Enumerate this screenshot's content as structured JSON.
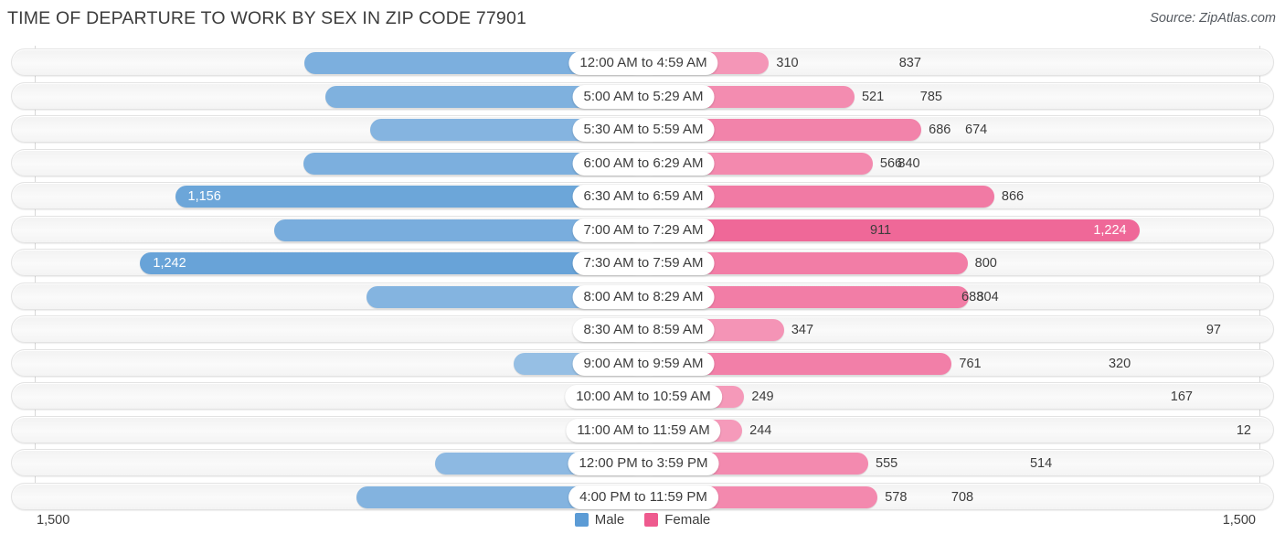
{
  "header": {
    "title": "TIME OF DEPARTURE TO WORK BY SEX IN ZIP CODE 77901",
    "source": "Source: ZipAtlas.com"
  },
  "legend": {
    "male_label": "Male",
    "female_label": "Female",
    "male_color": "#5b9bd5",
    "female_color": "#ee5a8e"
  },
  "axis": {
    "left_max_label": "1,500",
    "right_max_label": "1,500",
    "max_value": 1500
  },
  "chart_data": {
    "type": "bar",
    "title": "TIME OF DEPARTURE TO WORK BY SEX IN ZIP CODE 77901",
    "subtitle": "Source: ZipAtlas.com",
    "orientation": "horizontal-diverging",
    "xlabel": "",
    "ylabel": "",
    "xlim": [
      1500,
      1500
    ],
    "grid": true,
    "legend_position": "bottom-center",
    "categories": [
      "12:00 AM to 4:59 AM",
      "5:00 AM to 5:29 AM",
      "5:30 AM to 5:59 AM",
      "6:00 AM to 6:29 AM",
      "6:30 AM to 6:59 AM",
      "7:00 AM to 7:29 AM",
      "7:30 AM to 7:59 AM",
      "8:00 AM to 8:29 AM",
      "8:30 AM to 8:59 AM",
      "9:00 AM to 9:59 AM",
      "10:00 AM to 10:59 AM",
      "11:00 AM to 11:59 AM",
      "12:00 PM to 3:59 PM",
      "4:00 PM to 11:59 PM"
    ],
    "series": [
      {
        "name": "Male",
        "color": "#5b9bd5",
        "values": [
          837,
          785,
          674,
          840,
          1156,
          911,
          1242,
          683,
          97,
          320,
          167,
          12,
          514,
          708
        ],
        "labels": [
          "837",
          "785",
          "674",
          "840",
          "1,156",
          "911",
          "1,242",
          "683",
          "97",
          "320",
          "167",
          "12",
          "514",
          "708"
        ]
      },
      {
        "name": "Female",
        "color": "#ee5a8e",
        "values": [
          310,
          521,
          686,
          566,
          866,
          1224,
          800,
          804,
          347,
          761,
          249,
          244,
          555,
          578
        ],
        "labels": [
          "310",
          "521",
          "686",
          "566",
          "866",
          "1,224",
          "800",
          "804",
          "347",
          "761",
          "249",
          "244",
          "555",
          "578"
        ]
      }
    ]
  },
  "rows": [
    {
      "category": "12:00 AM to 4:59 AM",
      "male": 837,
      "male_label": "837",
      "female": 310,
      "female_label": "310"
    },
    {
      "category": "5:00 AM to 5:29 AM",
      "male": 785,
      "male_label": "785",
      "female": 521,
      "female_label": "521"
    },
    {
      "category": "5:30 AM to 5:59 AM",
      "male": 674,
      "male_label": "674",
      "female": 686,
      "female_label": "686"
    },
    {
      "category": "6:00 AM to 6:29 AM",
      "male": 840,
      "male_label": "840",
      "female": 566,
      "female_label": "566"
    },
    {
      "category": "6:30 AM to 6:59 AM",
      "male": 1156,
      "male_label": "1,156",
      "female": 866,
      "female_label": "866"
    },
    {
      "category": "7:00 AM to 7:29 AM",
      "male": 911,
      "male_label": "911",
      "female": 1224,
      "female_label": "1,224"
    },
    {
      "category": "7:30 AM to 7:59 AM",
      "male": 1242,
      "male_label": "1,242",
      "female": 800,
      "female_label": "800"
    },
    {
      "category": "8:00 AM to 8:29 AM",
      "male": 683,
      "male_label": "683",
      "female": 804,
      "female_label": "804"
    },
    {
      "category": "8:30 AM to 8:59 AM",
      "male": 97,
      "male_label": "97",
      "female": 347,
      "female_label": "347"
    },
    {
      "category": "9:00 AM to 9:59 AM",
      "male": 320,
      "male_label": "320",
      "female": 761,
      "female_label": "761"
    },
    {
      "category": "10:00 AM to 10:59 AM",
      "male": 167,
      "male_label": "167",
      "female": 249,
      "female_label": "249"
    },
    {
      "category": "11:00 AM to 11:59 AM",
      "male": 12,
      "male_label": "12",
      "female": 244,
      "female_label": "244"
    },
    {
      "category": "12:00 PM to 3:59 PM",
      "male": 514,
      "male_label": "514",
      "female": 555,
      "female_label": "555"
    },
    {
      "category": "4:00 PM to 11:59 PM",
      "male": 708,
      "male_label": "708",
      "female": 578,
      "female_label": "578"
    }
  ]
}
